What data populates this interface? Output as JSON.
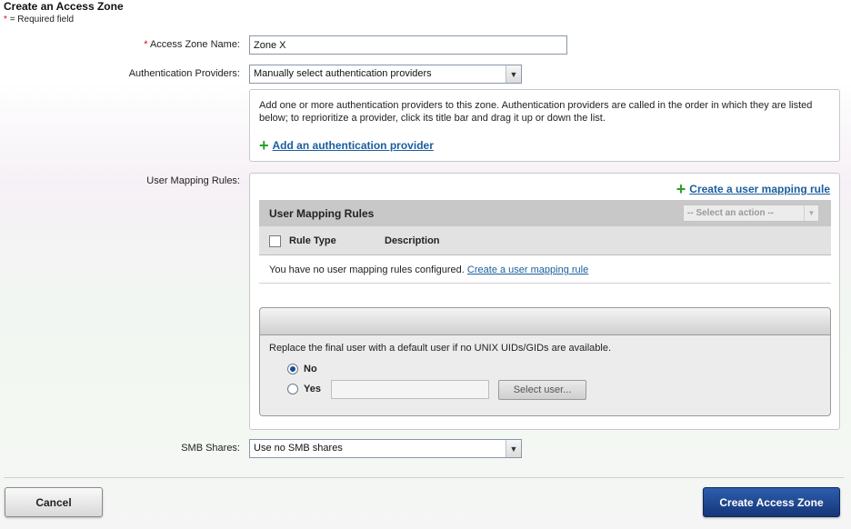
{
  "form": {
    "title": "Create an Access Zone",
    "required_star": "*",
    "required_note": "= Required field"
  },
  "zone_name": {
    "label": "Access Zone Name:",
    "value": "Zone X"
  },
  "auth_providers": {
    "label": "Authentication Providers:",
    "selected": "Manually select authentication providers",
    "info_text": "Add one or more authentication providers to this zone. Authentication providers are called in the order in which they are listed below; to reprioritize a provider, click its title bar and drag it up or down the list.",
    "add_link": "Add an authentication provider"
  },
  "user_mapping": {
    "label": "User Mapping Rules:",
    "create_link": "Create a user mapping rule",
    "table_title": "User Mapping Rules",
    "action_placeholder": "-- Select an action --",
    "columns": [
      "Rule Type",
      "Description"
    ],
    "empty_text": "You have no user mapping rules configured.",
    "empty_link": "Create a user mapping rule",
    "default_user_text": "Replace the final user with a default user if no UNIX UIDs/GIDs are available.",
    "option_no": "No",
    "option_yes": "Yes",
    "selected_option": "No",
    "user_field_value": "",
    "select_user_button": "Select user..."
  },
  "smb": {
    "label": "SMB Shares:",
    "selected": "Use no SMB shares"
  },
  "footer": {
    "cancel_label": "Cancel",
    "submit_label": "Create Access Zone"
  },
  "colors": {
    "primary_button": "#1f4a94",
    "link": "#1a5e9e",
    "plus_icon": "#2aa12a",
    "required_star": "#d01010"
  }
}
